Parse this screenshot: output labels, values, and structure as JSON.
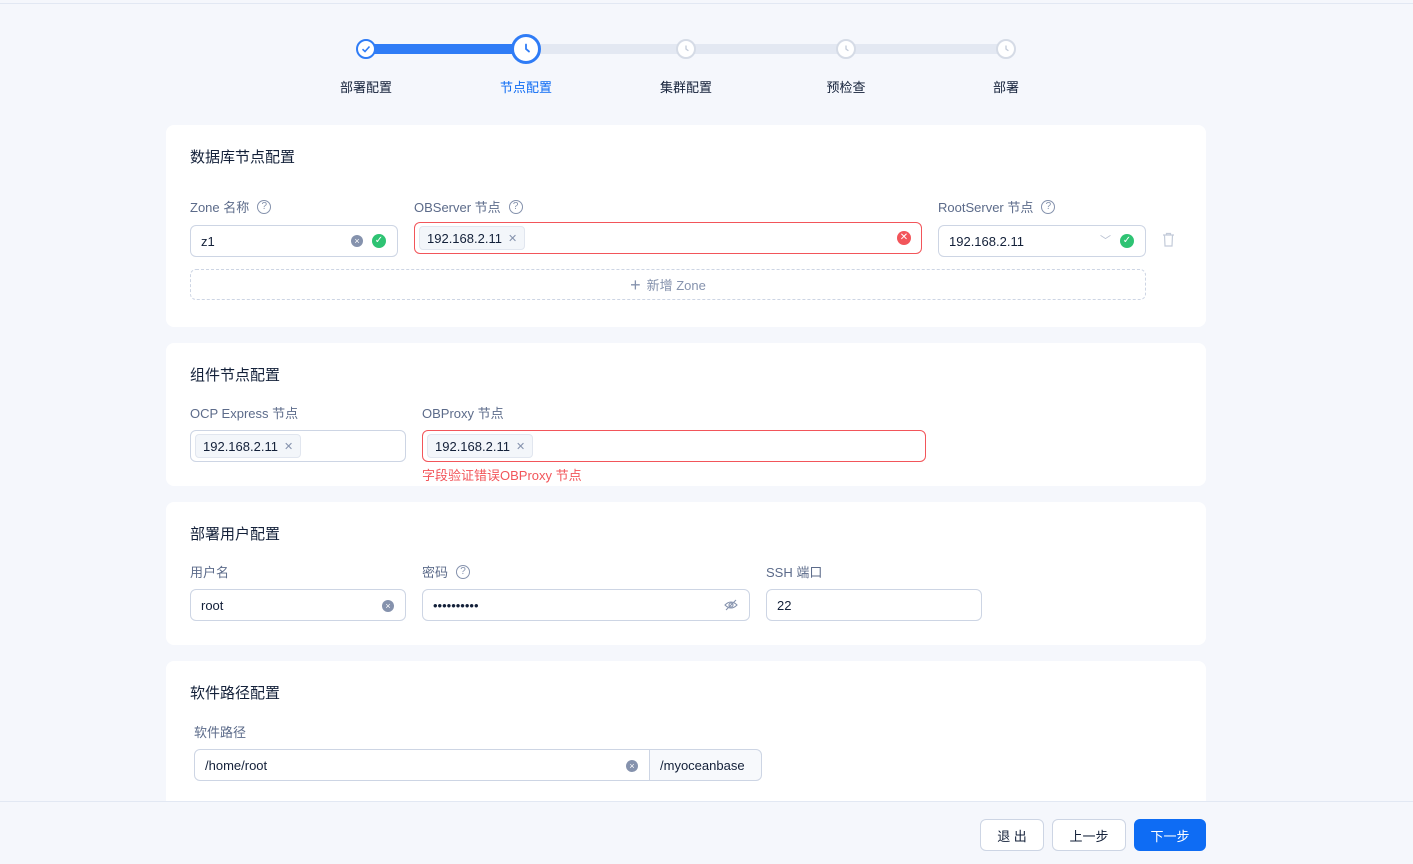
{
  "steps": [
    {
      "label": "部署配置",
      "state": "done"
    },
    {
      "label": "节点配置",
      "state": "active"
    },
    {
      "label": "集群配置",
      "state": "wait"
    },
    {
      "label": "预检查",
      "state": "wait"
    },
    {
      "label": "部署",
      "state": "wait"
    }
  ],
  "db_nodes": {
    "title": "数据库节点配置",
    "zone_label": "Zone 名称",
    "observer_label": "OBServer 节点",
    "rootserver_label": "RootServer 节点",
    "zone_value": "z1",
    "observer_tag": "192.168.2.11",
    "rootserver_value": "192.168.2.11",
    "add_zone_label": "新增 Zone"
  },
  "components": {
    "title": "组件节点配置",
    "ocp_label": "OCP Express 节点",
    "ocp_tag": "192.168.2.11",
    "obproxy_label": "OBProxy 节点",
    "obproxy_tag": "192.168.2.11",
    "obproxy_error": "字段验证错误OBProxy 节点"
  },
  "deploy_user": {
    "title": "部署用户配置",
    "username_label": "用户名",
    "username_value": "root",
    "password_label": "密码",
    "password_value": "••••••••••",
    "ssh_port_label": "SSH 端口",
    "ssh_port_value": "22"
  },
  "software_path": {
    "title": "软件路径配置",
    "path_label": "软件路径",
    "path_value": "/home/root",
    "path_suffix": "/myoceanbase"
  },
  "footer": {
    "exit_label": "退 出",
    "prev_label": "上一步",
    "next_label": "下一步"
  },
  "colors": {
    "primary": "#0e6cf4",
    "error": "#f2555a",
    "success": "#2ec373"
  }
}
